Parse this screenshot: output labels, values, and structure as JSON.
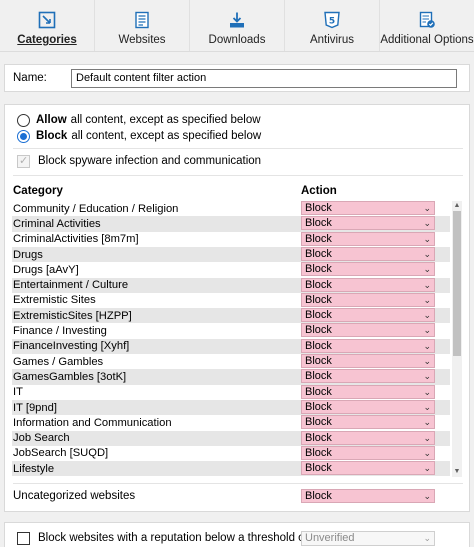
{
  "tabs": [
    {
      "label": "Categories",
      "icon": "categories-icon",
      "active": true
    },
    {
      "label": "Websites",
      "icon": "websites-icon"
    },
    {
      "label": "Downloads",
      "icon": "downloads-icon"
    },
    {
      "label": "Antivirus",
      "icon": "antivirus-icon"
    },
    {
      "label": "Additional Options",
      "icon": "additional-options-icon"
    }
  ],
  "name": {
    "label": "Name:",
    "value": "Default content filter action"
  },
  "mode": {
    "allow_bold": "Allow",
    "allow_rest": "all content, except as specified below",
    "block_bold": "Block",
    "block_rest": "all content, except as specified below",
    "selected": "block"
  },
  "spyware": {
    "label": "Block spyware infection and communication",
    "checked": true,
    "disabled": true
  },
  "table": {
    "col_category": "Category",
    "col_action": "Action",
    "rows": [
      {
        "category": "Community / Education / Religion",
        "action": "Block"
      },
      {
        "category": "Criminal Activities",
        "action": "Block"
      },
      {
        "category": "CriminalActivities [8m7m]",
        "action": "Block"
      },
      {
        "category": "Drugs",
        "action": "Block"
      },
      {
        "category": "Drugs [aAvY]",
        "action": "Block"
      },
      {
        "category": "Entertainment / Culture",
        "action": "Block"
      },
      {
        "category": "Extremistic Sites",
        "action": "Block"
      },
      {
        "category": "ExtremisticSites [HZPP]",
        "action": "Block"
      },
      {
        "category": "Finance / Investing",
        "action": "Block"
      },
      {
        "category": "FinanceInvesting [Xyhf]",
        "action": "Block"
      },
      {
        "category": "Games / Gambles",
        "action": "Block"
      },
      {
        "category": "GamesGambles [3otK]",
        "action": "Block"
      },
      {
        "category": "IT",
        "action": "Block"
      },
      {
        "category": "IT [9pnd]",
        "action": "Block"
      },
      {
        "category": "Information and Communication",
        "action": "Block"
      },
      {
        "category": "Job Search",
        "action": "Block"
      },
      {
        "category": "JobSearch [SUQD]",
        "action": "Block"
      },
      {
        "category": "Lifestyle",
        "action": "Block"
      }
    ]
  },
  "uncategorized": {
    "label": "Uncategorized websites",
    "action": "Block"
  },
  "reputation": {
    "label": "Block websites with a reputation below a threshold of:",
    "value": "Unverified",
    "checked": false
  },
  "colors": {
    "action_bg": "#f7c4d2",
    "radio_accent": "#1a6fd4"
  }
}
